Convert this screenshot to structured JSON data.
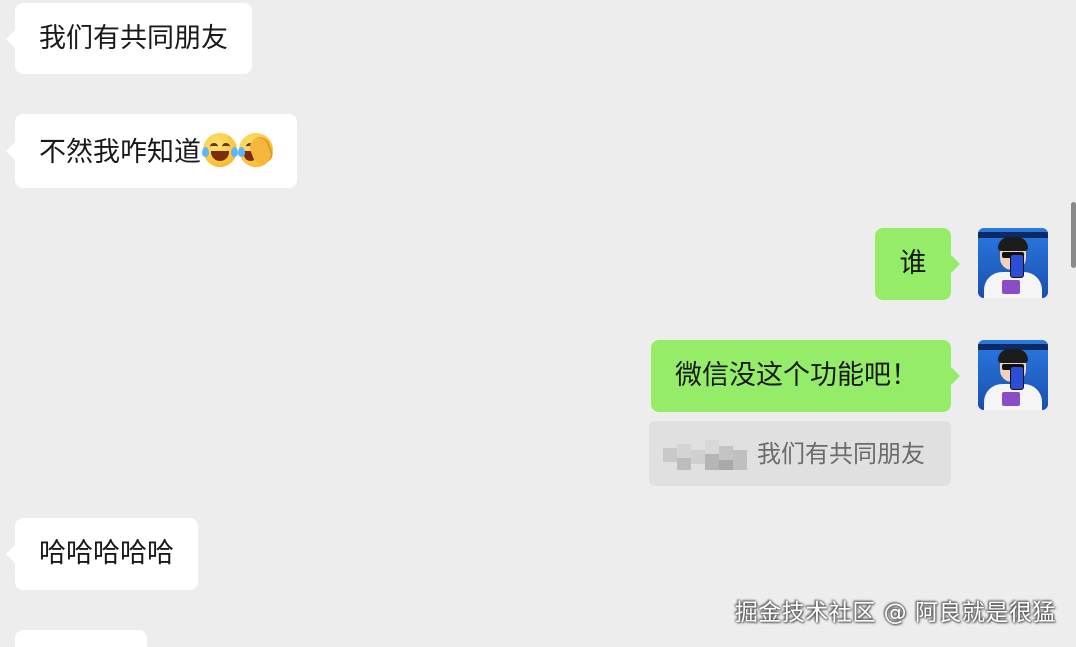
{
  "messages": [
    {
      "side": "in",
      "text": "我们有共同朋友"
    },
    {
      "side": "in",
      "text": "不然我咋知道",
      "emojis": [
        "face-with-tears-of-joy-icon",
        "facepalm-icon"
      ]
    },
    {
      "side": "out",
      "text": "谁"
    },
    {
      "side": "out",
      "text": "微信没这个功能吧！",
      "quote": {
        "text": "我们有共同朋友",
        "sender_obscured": true
      }
    },
    {
      "side": "in",
      "text": "哈哈哈哈哈"
    },
    {
      "side": "in",
      "text": ""
    }
  ],
  "watermark": "掘金技术社区 @ 阿良就是很猛",
  "colors": {
    "background": "#ededed",
    "incoming_bubble": "#ffffff",
    "outgoing_bubble": "#95ec69",
    "quote_block": "#e0e0e0"
  }
}
